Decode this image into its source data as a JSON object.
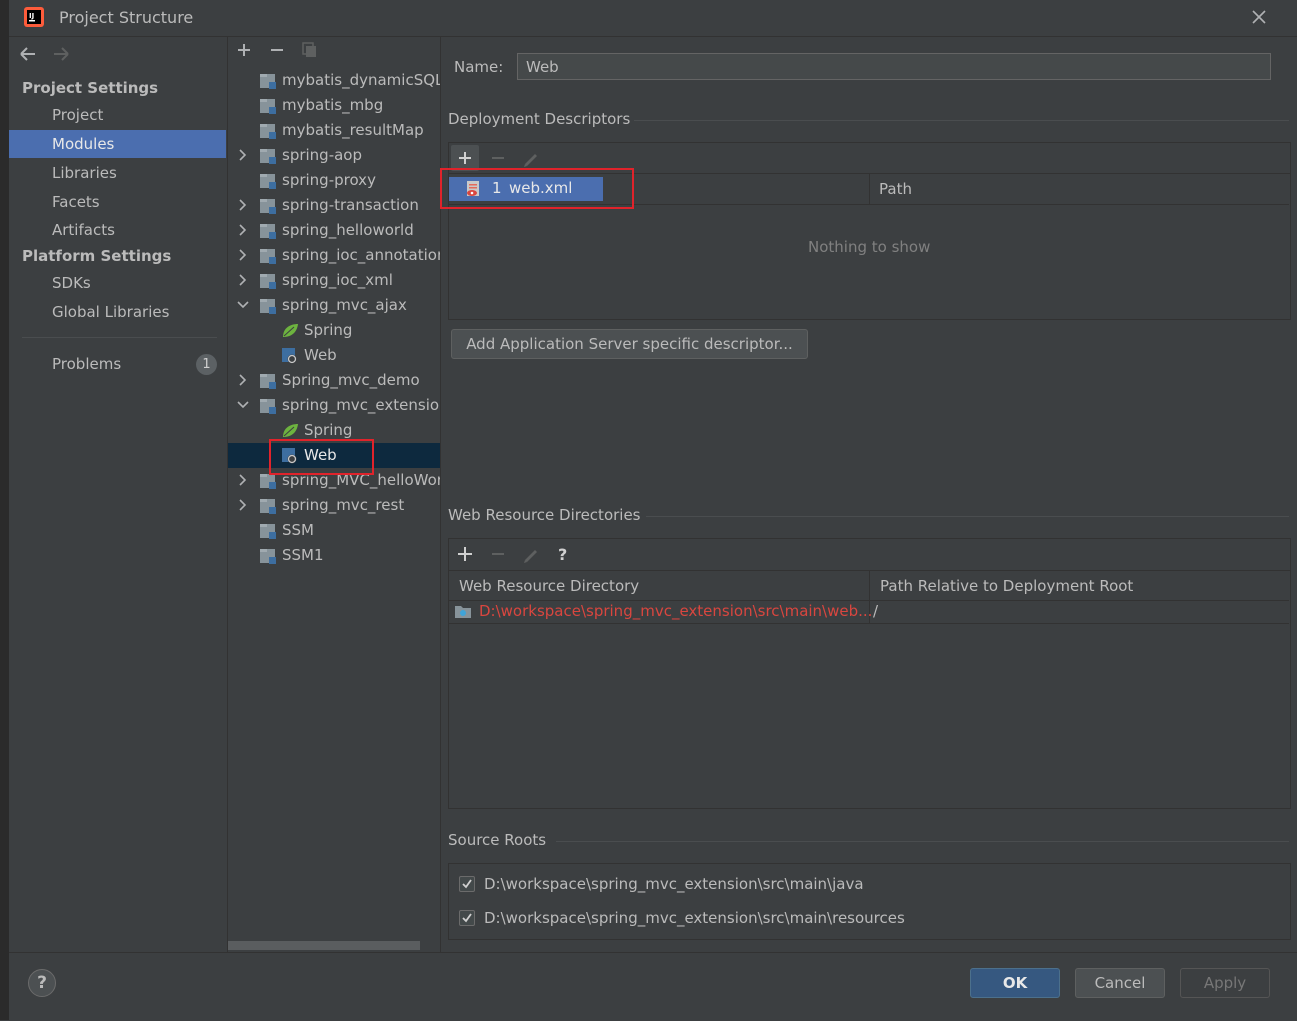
{
  "dialog": {
    "title": "Project Structure"
  },
  "sidebar": {
    "project_settings_title": "Project Settings",
    "platform_settings_title": "Platform Settings",
    "items": [
      {
        "label": "Project"
      },
      {
        "label": "Modules"
      },
      {
        "label": "Libraries"
      },
      {
        "label": "Facets"
      },
      {
        "label": "Artifacts"
      },
      {
        "label": "SDKs"
      },
      {
        "label": "Global Libraries"
      },
      {
        "label": "Problems"
      }
    ],
    "problems_count": "1",
    "selected": "Modules"
  },
  "tree": {
    "rows": [
      {
        "label": "mybatis_dynamicSQL",
        "type": "module"
      },
      {
        "label": "mybatis_mbg",
        "type": "module"
      },
      {
        "label": "mybatis_resultMap",
        "type": "module"
      },
      {
        "label": "spring-aop",
        "type": "module",
        "expandable": "collapsed"
      },
      {
        "label": "spring-proxy",
        "type": "module"
      },
      {
        "label": "spring-transaction",
        "type": "module",
        "expandable": "collapsed"
      },
      {
        "label": "spring_helloworld",
        "type": "module",
        "expandable": "collapsed"
      },
      {
        "label": "spring_ioc_annotation",
        "type": "module",
        "expandable": "collapsed"
      },
      {
        "label": "spring_ioc_xml",
        "type": "module",
        "expandable": "collapsed"
      },
      {
        "label": "spring_mvc_ajax",
        "type": "module",
        "expandable": "expanded"
      },
      {
        "label": "Spring",
        "type": "spring-facet"
      },
      {
        "label": "Web",
        "type": "web-facet"
      },
      {
        "label": "Spring_mvc_demo",
        "type": "module",
        "expandable": "collapsed"
      },
      {
        "label": "spring_mvc_extension",
        "type": "module",
        "expandable": "expanded"
      },
      {
        "label": "Spring",
        "type": "spring-facet"
      },
      {
        "label": "Web",
        "type": "web-facet",
        "selected": true
      },
      {
        "label": "spring_MVC_helloWorld",
        "type": "module",
        "expandable": "collapsed"
      },
      {
        "label": "spring_mvc_rest",
        "type": "module",
        "expandable": "collapsed"
      },
      {
        "label": "SSM",
        "type": "module"
      },
      {
        "label": "SSM1",
        "type": "module"
      }
    ]
  },
  "detail": {
    "name_label": "Name:",
    "name_value": "Web",
    "deployment_descriptors": {
      "title": "Deployment Descriptors",
      "row_index": "1",
      "row_file": "web.xml",
      "path_header": "Path",
      "empty_text": "Nothing to show",
      "add_server_button": "Add Application Server specific descriptor..."
    },
    "web_resource_directories": {
      "title": "Web Resource Directories",
      "col1_header": "Web Resource Directory",
      "col2_header": "Path Relative to Deployment Root",
      "row_dir": "D:\\workspace\\spring_mvc_extension\\src\\main\\web...",
      "row_path": "/"
    },
    "source_roots": {
      "title": "Source Roots",
      "items": [
        {
          "label": "D:\\workspace\\spring_mvc_extension\\src\\main\\java",
          "checked": true
        },
        {
          "label": "D:\\workspace\\spring_mvc_extension\\src\\main\\resources",
          "checked": true
        }
      ]
    }
  },
  "footer": {
    "help": "?",
    "ok": "OK",
    "cancel": "Cancel",
    "apply": "Apply"
  },
  "colors": {
    "background": "#3c3f41",
    "selection": "#4b6eaf",
    "tree_selection": "#0d293e",
    "error_text": "#d9463f",
    "highlight_box": "#e0232b"
  }
}
